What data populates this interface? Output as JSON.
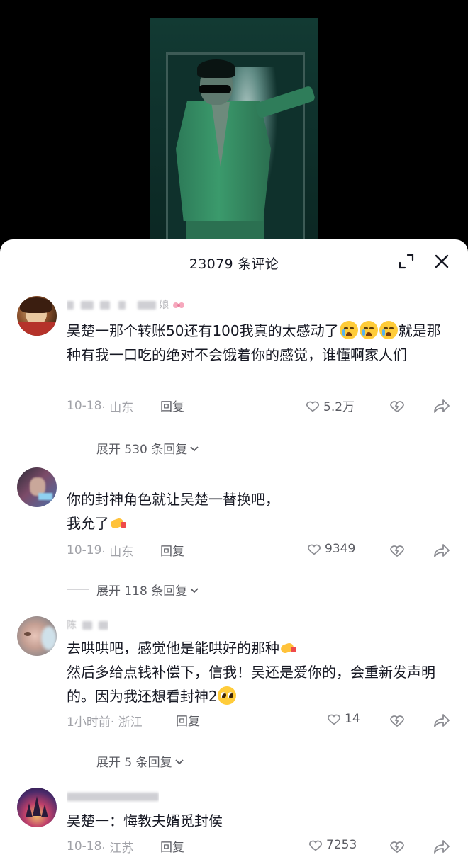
{
  "sheet": {
    "title": "23079 条评论"
  },
  "comments": [
    {
      "username": "娘",
      "text_parts": [
        "吴楚一那个转账50还有100我真的太感动了",
        "",
        "",
        "就是那种有我一口吃的绝对不会饿着你的感觉，谁懂啊家人们"
      ],
      "date": "10-18",
      "location": "· 山东",
      "reply_label": "回复",
      "likes": "5.2万",
      "expand_label": "展开 530 条回复"
    },
    {
      "username": "",
      "text_parts": [
        "你的封神角色就让吴楚一替换吧，",
        "我允了"
      ],
      "date": "10-19",
      "location": "· 山东",
      "reply_label": "回复",
      "likes": "9349",
      "expand_label": "展开 118 条回复"
    },
    {
      "username": "陈",
      "text_parts": [
        "去哄哄吧，感觉他是能哄好的那种",
        "然后多给点钱补偿下，信我！吴还是爱你的，会重新发声明的。因为我还想看封神2"
      ],
      "date": "1小时前",
      "location": "· 浙江",
      "reply_label": "回复",
      "likes": "14",
      "expand_label": "展开 5 条回复"
    },
    {
      "username": "",
      "text_parts": [
        "吴楚一：悔教夫婿觅封侯"
      ],
      "date": "10-18",
      "location": "· 江苏",
      "reply_label": "回复",
      "likes": "7253"
    }
  ],
  "icons": {
    "expand": "expand-icon",
    "close": "close-icon",
    "heart": "heart-icon",
    "dislike": "dislike-heart-icon",
    "share": "share-arrow-icon",
    "chevron": "chevron-down-icon"
  },
  "colors": {
    "text": "#161823",
    "meta": "#a1a2a8",
    "action": "#5a5b62"
  }
}
